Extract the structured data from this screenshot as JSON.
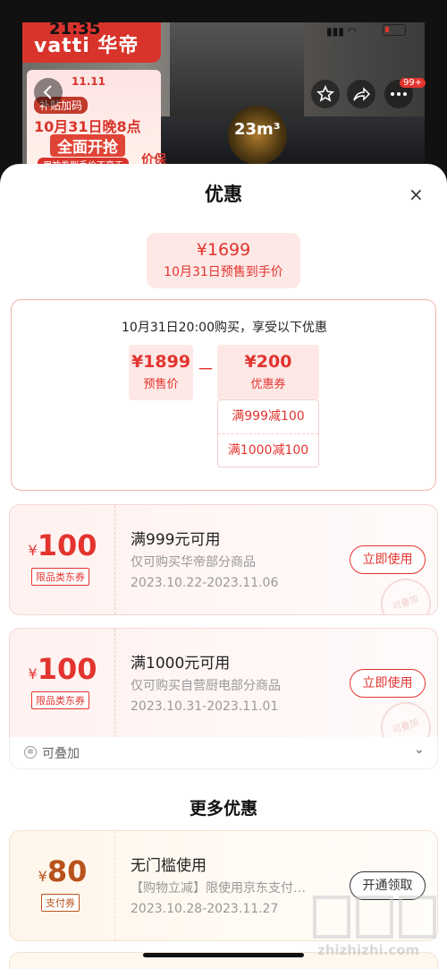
{
  "status_bar": {
    "time": "21:35",
    "signal": "▮▮▮ ◠"
  },
  "product": {
    "brand": "vatti 华帝",
    "promo": {
      "event": "11.11",
      "line1": "补贴加码",
      "line2": "10月31日晚8点",
      "line3": "全面开抢",
      "line4": "用神券到手价不高于",
      "line5": "价保"
    },
    "dial_label": "23m³",
    "badge_count": "99+"
  },
  "sheet": {
    "title": "优惠",
    "close_icon": "×",
    "final_price": "¥1699",
    "final_caption": "10月31日预售到手价",
    "calc": {
      "header": "10月31日20:00购买，享受以下优惠",
      "presale_price": "¥1899",
      "presale_label": "预售价",
      "operator": "－",
      "coupon_amount": "¥200",
      "coupon_label": "优惠券",
      "coupon_breakdown": [
        "满999减100",
        "满1000减100"
      ]
    },
    "coupons": [
      {
        "currency": "¥",
        "amount": "100",
        "tag": "限品类东券",
        "title": "满999元可用",
        "desc": "仅可购买华帝部分商品",
        "date": "2023.10.22-2023.11.06",
        "button": "立即使用",
        "stamp": "可叠加"
      },
      {
        "currency": "¥",
        "amount": "100",
        "tag": "限品类东券",
        "title": "满1000元可用",
        "desc": "仅可购买自营厨电部分商品",
        "date": "2023.10.31-2023.11.01",
        "button": "立即使用",
        "stamp": "可叠加"
      }
    ],
    "stackable_label": "可叠加",
    "more_title": "更多优惠",
    "pay_coupon": {
      "currency": "¥",
      "amount": "80",
      "tag": "支付券",
      "title": "无门槛使用",
      "desc": "【购物立减】限使用京东支付…",
      "date": "2023.10.28-2023.11.27",
      "button": "开通领取"
    }
  },
  "watermark": "zhizhizhi.com",
  "colors": {
    "accent": "#e3342f",
    "pay_accent": "#b8521b"
  }
}
